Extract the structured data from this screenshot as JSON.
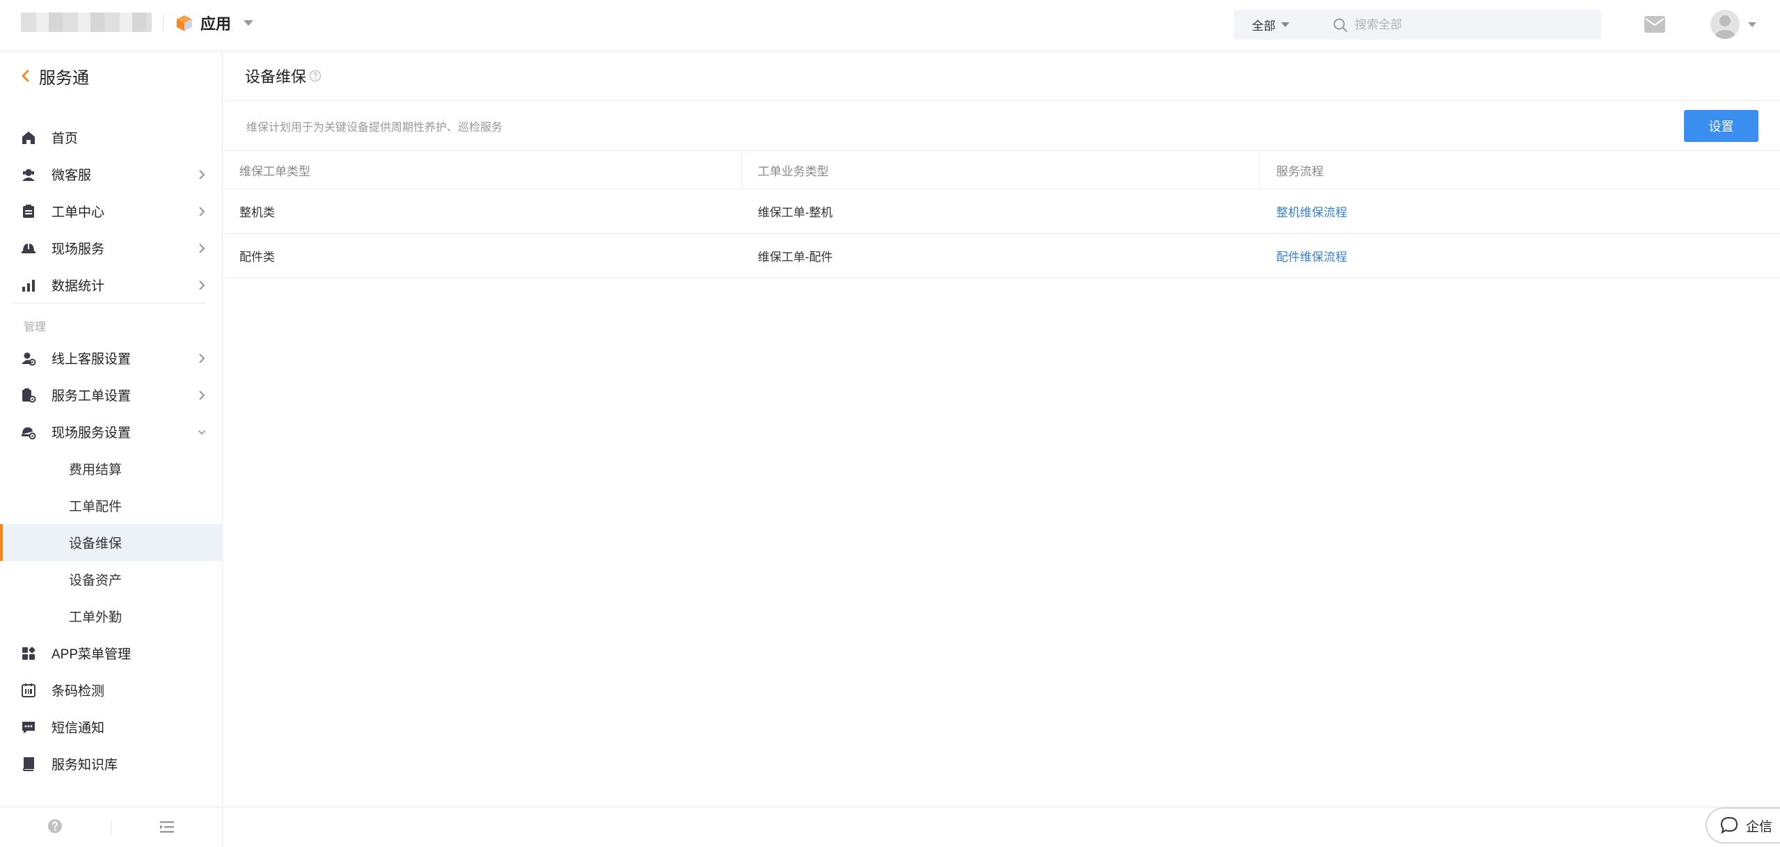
{
  "header": {
    "app_label": "应用",
    "search": {
      "scope": "全部",
      "placeholder": "搜索全部"
    }
  },
  "sidebar": {
    "title": "服务通",
    "items": [
      {
        "label": "首页",
        "icon": "home-icon",
        "chevron": false
      },
      {
        "label": "微客服",
        "icon": "agent-icon",
        "chevron": true
      },
      {
        "label": "工单中心",
        "icon": "ticket-icon",
        "chevron": true
      },
      {
        "label": "现场服务",
        "icon": "helmet-icon",
        "chevron": true
      },
      {
        "label": "数据统计",
        "icon": "bar-chart-icon",
        "chevron": true
      }
    ],
    "group_label": "管理",
    "manage_items": [
      {
        "label": "线上客服设置",
        "icon": "agent-gear-icon",
        "chevron": "right"
      },
      {
        "label": "服务工单设置",
        "icon": "ticket-gear-icon",
        "chevron": "right"
      },
      {
        "label": "现场服务设置",
        "icon": "helmet-gear-icon",
        "chevron": "down"
      }
    ],
    "sub_items": [
      {
        "label": "费用结算",
        "active": false
      },
      {
        "label": "工单配件",
        "active": false
      },
      {
        "label": "设备维保",
        "active": true
      },
      {
        "label": "设备资产",
        "active": false
      },
      {
        "label": "工单外勤",
        "active": false
      }
    ],
    "bottom_items": [
      {
        "label": "APP菜单管理",
        "icon": "app-grid-icon"
      },
      {
        "label": "条码检测",
        "icon": "barcode-icon"
      },
      {
        "label": "短信通知",
        "icon": "sms-icon"
      },
      {
        "label": "服务知识库",
        "icon": "book-icon"
      }
    ]
  },
  "main": {
    "page_title": "设备维保",
    "description": "维保计划用于为关键设备提供周期性养护、巡检服务",
    "settings_button": "设置",
    "table": {
      "columns": [
        "维保工单类型",
        "工单业务类型",
        "服务流程"
      ],
      "rows": [
        [
          "整机类",
          "维保工单-整机",
          "整机维保流程"
        ],
        [
          "配件类",
          "维保工单-配件",
          "配件维保流程"
        ]
      ]
    }
  },
  "chat_widget": {
    "label": "企信"
  },
  "colors": {
    "accent": "#f5871f",
    "primary": "#3a8ef0",
    "link": "#3a7fd6",
    "active_bg": "#edf1f8"
  }
}
